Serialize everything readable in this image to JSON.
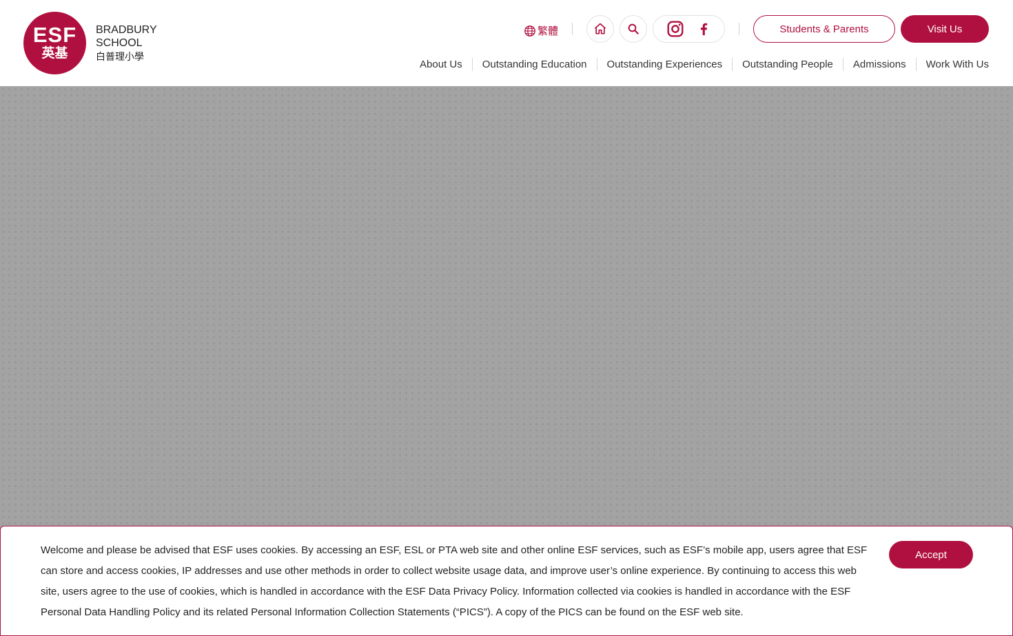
{
  "brand": {
    "logo_esf": "ESF",
    "logo_cjk": "英基",
    "school_line1": "BRADBURY",
    "school_line2": "SCHOOL",
    "school_cjk": "白普理小學",
    "accent_color": "#b0103f"
  },
  "header": {
    "language_label": "繁體",
    "language_icon": "globe-icon",
    "home_icon": "home-icon",
    "search_icon": "search-icon",
    "instagram_icon": "instagram-icon",
    "facebook_icon": "facebook-icon",
    "students_parents_label": "Students & Parents",
    "visit_label": "Visit Us"
  },
  "nav": {
    "items": [
      {
        "label": "About Us"
      },
      {
        "label": "Outstanding Education"
      },
      {
        "label": "Outstanding Experiences"
      },
      {
        "label": "Outstanding People"
      },
      {
        "label": "Admissions"
      },
      {
        "label": "Work With Us"
      }
    ]
  },
  "cookie_banner": {
    "text": "Welcome and please be advised that ESF uses cookies. By accessing an ESF, ESL or PTA web site and other online ESF services, such as ESF’s mobile app, users agree that ESF can store and access cookies, IP addresses and use other methods in order to collect website usage data, and improve user’s online experience. By continuing to access this web site, users agree to the use of cookies, which is handled in accordance with the ESF Data Privacy Policy. Information collected via cookies is handled in accordance with the ESF Personal Data Handling Policy and its related Personal Information Collection Statements (“PICS”). A copy of the PICS can be found on the ESF web site.",
    "accept_label": "Accept"
  }
}
